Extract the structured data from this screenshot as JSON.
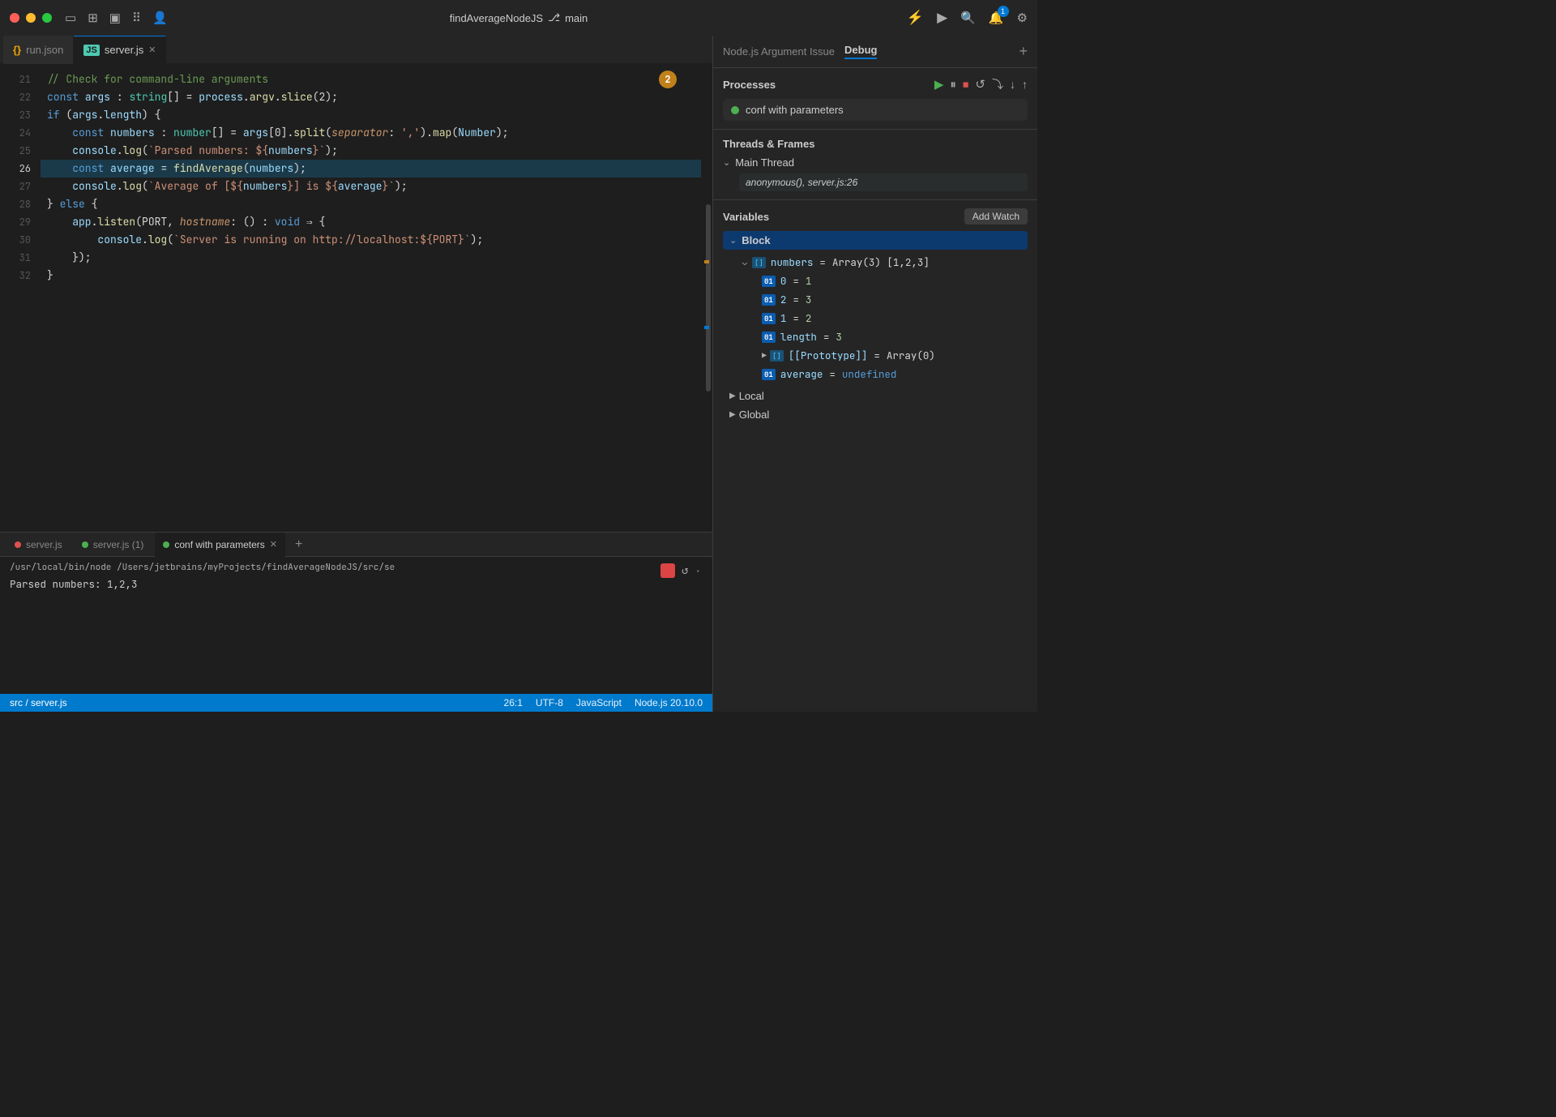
{
  "titlebar": {
    "project_name": "findAverageNodeJS",
    "branch_icon": "⎇",
    "branch": "main",
    "icons": [
      "⚡",
      "▶",
      "🔍",
      "🔔",
      "⚙"
    ]
  },
  "editor": {
    "tabs": [
      {
        "id": "run-json",
        "icon": "{}",
        "label": "run.json",
        "active": false,
        "closable": false
      },
      {
        "id": "server-js",
        "icon": "JS",
        "label": "server.js",
        "active": true,
        "closable": true
      }
    ],
    "badge": "2",
    "lines": [
      {
        "num": "21",
        "content": "cm_check_command_line_args"
      },
      {
        "num": "22",
        "content": "const_args_string"
      },
      {
        "num": "23",
        "content": "if_args_length"
      },
      {
        "num": "24",
        "content": "const_numbers_args"
      },
      {
        "num": "25",
        "content": "console_log_parsed"
      },
      {
        "num": "26",
        "content": "const_average_find",
        "breakpoint": true,
        "highlighted": true
      },
      {
        "num": "27",
        "content": "console_log_average"
      },
      {
        "num": "28",
        "content": "else_block"
      },
      {
        "num": "29",
        "content": "app_listen"
      },
      {
        "num": "30",
        "content": "console_log_server"
      },
      {
        "num": "31",
        "content": "bracket_close_1"
      },
      {
        "num": "32",
        "content": "bracket_close_2"
      }
    ]
  },
  "debug_panel": {
    "inactive_tab": "Node.js Argument Issue",
    "active_tab": "Debug",
    "add_label": "+",
    "processes": {
      "title": "Processes",
      "toolbar": [
        "▶",
        "⏸",
        "⏹",
        "↺",
        "↓",
        "↑"
      ],
      "items": [
        {
          "name": "conf with parameters",
          "status": "running"
        }
      ]
    },
    "threads": {
      "title": "Threads & Frames",
      "items": [
        {
          "name": "Main Thread",
          "expanded": true,
          "frames": [
            "anonymous(), server.js:26"
          ]
        }
      ]
    },
    "variables": {
      "title": "Variables",
      "add_watch": "Add Watch",
      "groups": [
        {
          "name": "Block",
          "expanded": true,
          "items": [
            {
              "indent": 1,
              "expandable": true,
              "badge": "[]",
              "name": "numbers",
              "eq": "=",
              "value": "Array(3) [1,2,3]",
              "value_type": "plain",
              "sub_items": [
                {
                  "indent": 2,
                  "badge": "01",
                  "name": "0",
                  "eq": "=",
                  "value": "1",
                  "value_type": "num"
                },
                {
                  "indent": 2,
                  "badge": "01",
                  "name": "2",
                  "eq": "=",
                  "value": "3",
                  "value_type": "num"
                },
                {
                  "indent": 2,
                  "badge": "01",
                  "name": "1",
                  "eq": "=",
                  "value": "2",
                  "value_type": "num"
                },
                {
                  "indent": 2,
                  "badge": "01",
                  "name": "length",
                  "eq": "=",
                  "value": "3",
                  "value_type": "num"
                },
                {
                  "indent": 2,
                  "expandable": true,
                  "badge": "[]",
                  "name": "[[Prototype]]",
                  "eq": "=",
                  "value": "Array(0)",
                  "value_type": "plain"
                },
                {
                  "indent": 2,
                  "badge": "01",
                  "name": "average",
                  "eq": "=",
                  "value": "undefined",
                  "value_type": "undef"
                }
              ]
            }
          ]
        },
        {
          "name": "Local",
          "expanded": false
        },
        {
          "name": "Global",
          "expanded": false
        }
      ]
    }
  },
  "terminal": {
    "tabs": [
      {
        "label": "server.js",
        "dot_color": "#e05050",
        "active": false
      },
      {
        "label": "server.js (1)",
        "dot_color": "#4caf50",
        "active": false
      },
      {
        "label": "conf with parameters",
        "dot_color": "#4caf50",
        "active": true,
        "closable": true
      }
    ],
    "add_label": "+",
    "command": "/usr/local/bin/node /Users/jetbrains/myProjects/findAverageNodeJS/src/se",
    "output": "Parsed numbers: 1,2,3"
  },
  "status_bar": {
    "breadcrumb": "src / server.js",
    "position": "26:1",
    "encoding": "UTF-8",
    "language": "JavaScript",
    "runtime": "Node.js 20.10.0"
  }
}
